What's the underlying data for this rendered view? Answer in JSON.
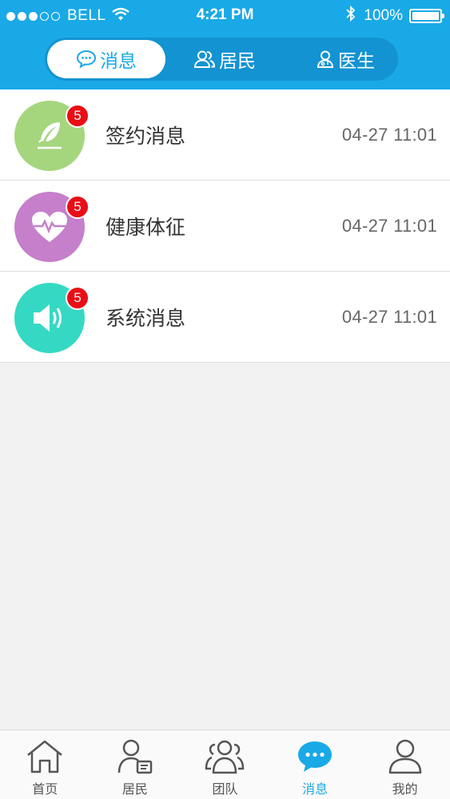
{
  "status_bar": {
    "carrier": "BELL",
    "time": "4:21 PM",
    "battery": "100%"
  },
  "segment_tabs": [
    {
      "label": "消息",
      "icon": "chat-bubble-icon",
      "active": true
    },
    {
      "label": "居民",
      "icon": "people-icon",
      "active": false
    },
    {
      "label": "医生",
      "icon": "doctor-icon",
      "active": false
    }
  ],
  "messages": [
    {
      "title": "签约消息",
      "time": "04-27 11:01",
      "badge": "5",
      "icon": "feather-pen-icon",
      "color": "#a5d67e"
    },
    {
      "title": "健康体征",
      "time": "04-27 11:01",
      "badge": "5",
      "icon": "heart-pulse-icon",
      "color": "#c57fcb"
    },
    {
      "title": "系统消息",
      "time": "04-27 11:01",
      "badge": "5",
      "icon": "speaker-icon",
      "color": "#35d9c3"
    }
  ],
  "tab_bar": [
    {
      "label": "首页",
      "icon": "home-icon",
      "active": false
    },
    {
      "label": "居民",
      "icon": "resident-card-icon",
      "active": false
    },
    {
      "label": "团队",
      "icon": "team-icon",
      "active": false
    },
    {
      "label": "消息",
      "icon": "message-bubble-icon",
      "active": true
    },
    {
      "label": "我的",
      "icon": "profile-icon",
      "active": false
    }
  ],
  "colors": {
    "primary": "#19a9e6",
    "badge": "#e90e16",
    "background": "#f2f2f2"
  }
}
